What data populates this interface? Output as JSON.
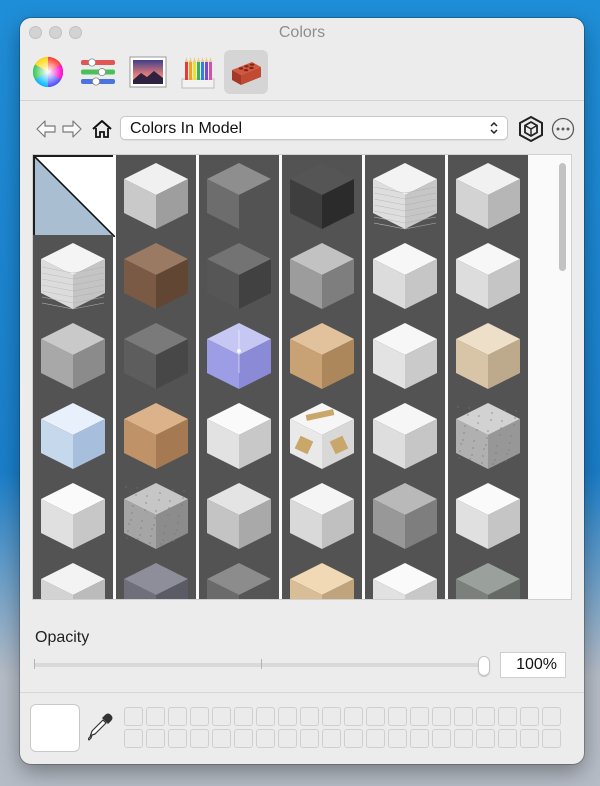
{
  "window": {
    "title": "Colors"
  },
  "toolbar": {
    "tools": [
      {
        "name": "color-wheel-tool",
        "icon": "color-wheel-icon"
      },
      {
        "name": "color-sliders-tool",
        "icon": "sliders-icon"
      },
      {
        "name": "image-palettes-tool",
        "icon": "image-icon"
      },
      {
        "name": "pencils-tool",
        "icon": "pencils-icon"
      },
      {
        "name": "materials-tool",
        "icon": "brick-icon",
        "selected": true
      }
    ]
  },
  "nav": {
    "collection_value": "Colors In Model",
    "back_icon": "back-arrow-icon",
    "forward_icon": "forward-arrow-icon",
    "home_icon": "home-icon",
    "model_icon": "in-model-icon",
    "more_icon": "ellipsis-icon"
  },
  "materials": [
    {
      "name": "default-material",
      "kind": "default",
      "selected": true
    },
    {
      "name": "material-2",
      "top": "#f0f0f0",
      "left": "#c9c9c9",
      "right": "#9e9e9e"
    },
    {
      "name": "material-3",
      "top": "#8e8e8e",
      "left": "#6d6d6d",
      "right": "#535353"
    },
    {
      "name": "material-4",
      "top": "#555555",
      "left": "#3e3e3e",
      "right": "#2b2b2b"
    },
    {
      "name": "material-5",
      "top": "#f3f3f3",
      "left": "#dedede",
      "right": "#c6c6c6",
      "texture": "lines"
    },
    {
      "name": "material-6",
      "top": "#f1f1f1",
      "left": "#d3d3d3",
      "right": "#b6b6b6"
    },
    {
      "name": "material-7",
      "top": "#f4f4f4",
      "left": "#dcdcdc",
      "right": "#c4c4c4",
      "texture": "lines"
    },
    {
      "name": "material-8",
      "top": "#9a7a63",
      "left": "#7a5a44",
      "right": "#624634"
    },
    {
      "name": "material-9",
      "top": "#737373",
      "left": "#565656",
      "right": "#414141"
    },
    {
      "name": "material-10",
      "top": "#c2c2c2",
      "left": "#9c9c9c",
      "right": "#7e7e7e"
    },
    {
      "name": "material-11",
      "top": "#f7f7f7",
      "left": "#dcdcdc",
      "right": "#c6c6c6"
    },
    {
      "name": "material-12",
      "top": "#f7f7f7",
      "left": "#dddddd",
      "right": "#c5c5c5"
    },
    {
      "name": "material-13",
      "top": "#c9c9c9",
      "left": "#a8a8a8",
      "right": "#8b8b8b"
    },
    {
      "name": "material-14",
      "top": "#7a7a7a",
      "left": "#5d5d5d",
      "right": "#474747"
    },
    {
      "name": "material-15",
      "top": "#c7c7f3",
      "left": "#9d9de6",
      "right": "#8a8ad6",
      "texture": "glass"
    },
    {
      "name": "material-16",
      "top": "#e2c29c",
      "left": "#c8a274",
      "right": "#ac875c"
    },
    {
      "name": "material-17",
      "top": "#f7f7f7",
      "left": "#e3e3e3",
      "right": "#cacaca"
    },
    {
      "name": "material-18",
      "top": "#eedfc9",
      "left": "#d8c4a6",
      "right": "#bda98c"
    },
    {
      "name": "material-19",
      "top": "#e8f1fb",
      "left": "#c6d8ec",
      "right": "#a7bfdc"
    },
    {
      "name": "material-20",
      "top": "#dcb28a",
      "left": "#bf9268",
      "right": "#a57a53"
    },
    {
      "name": "material-21",
      "top": "#fafafa",
      "left": "#e2e2e2",
      "right": "#c8c8c8"
    },
    {
      "name": "material-22",
      "top": "#f6f6f6",
      "left": "#e9e9e9",
      "right": "#d8d8d8",
      "texture": "labels"
    },
    {
      "name": "material-23",
      "top": "#f6f6f6",
      "left": "#dedede",
      "right": "#c6c6c6"
    },
    {
      "name": "material-24",
      "top": "#d2d2d2",
      "left": "#b0b0b0",
      "right": "#979797",
      "texture": "speckle"
    },
    {
      "name": "material-25",
      "top": "#fafafa",
      "left": "#e0e0e0",
      "right": "#c7c7c7"
    },
    {
      "name": "material-26",
      "top": "#c6c6c6",
      "left": "#a5a5a5",
      "right": "#8c8c8c",
      "texture": "speckle"
    },
    {
      "name": "material-27",
      "top": "#e4e4e4",
      "left": "#c4c4c4",
      "right": "#a9a9a9"
    },
    {
      "name": "material-28",
      "top": "#f5f5f5",
      "left": "#d9d9d9",
      "right": "#c0c0c0"
    },
    {
      "name": "material-29",
      "top": "#b9b9b9",
      "left": "#989898",
      "right": "#7e7e7e"
    },
    {
      "name": "material-30",
      "top": "#fafafa",
      "left": "#e0e0e0",
      "right": "#c5c5c5"
    },
    {
      "name": "material-31",
      "top": "#f3f3f3",
      "left": "#d3d3d3",
      "right": "#bbbbbb"
    },
    {
      "name": "material-32",
      "top": "#8e8e9a",
      "left": "#6f6f7b",
      "right": "#5b5b66"
    },
    {
      "name": "material-33",
      "top": "#8c8c8c",
      "left": "#6a6a6a",
      "right": "#555555"
    },
    {
      "name": "material-34",
      "top": "#f1d9b5",
      "left": "#d9bd96",
      "right": "#c0a47e"
    },
    {
      "name": "material-35",
      "top": "#fafafa",
      "left": "#e1e1e1",
      "right": "#c8c8c8"
    },
    {
      "name": "material-36",
      "top": "#9aa09c",
      "left": "#7b807c",
      "right": "#666a67"
    }
  ],
  "opacity": {
    "label": "Opacity",
    "value_text": "100%",
    "value": 1.0
  },
  "bottom": {
    "eyedropper_icon": "eyedropper-icon",
    "well_count": 40
  }
}
